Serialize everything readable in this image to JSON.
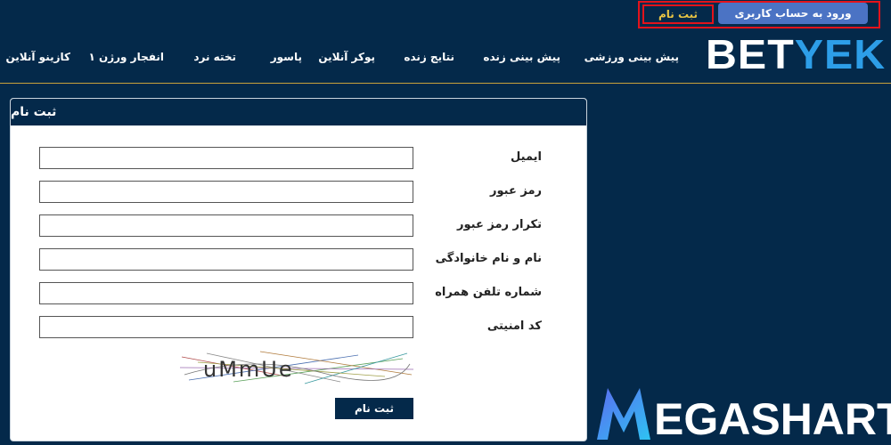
{
  "auth": {
    "register_label": "ثبت نام",
    "login_label": "ورود به حساب کاربری"
  },
  "logo": {
    "part1": "BET",
    "part2": "YEK"
  },
  "nav": {
    "items": [
      "پیش بینی ورزشی",
      "پیش بینی زنده",
      "نتایج زنده",
      "پوکر آنلاین",
      "پاسور",
      "تخته نرد",
      "انفجار ورژن ۱",
      "کازینو آنلاین"
    ]
  },
  "form": {
    "title": "ثبت نام",
    "fields": [
      {
        "label": "ایمیل",
        "value": ""
      },
      {
        "label": "رمز عبور",
        "value": ""
      },
      {
        "label": "تکرار رمز عبور",
        "value": ""
      },
      {
        "label": "نام و نام خانوادگی",
        "value": ""
      },
      {
        "label": "شماره تلفن همراه",
        "value": ""
      },
      {
        "label": "کد امنیتی",
        "value": ""
      }
    ],
    "captcha_text": "uMmUe",
    "submit_label": "ثبت نام"
  },
  "watermark": {
    "text": "EGASHART"
  },
  "colors": {
    "background": "#04294a",
    "accent_red": "#e3131b",
    "accent_gold": "#e8c443",
    "login_blue": "#4b73c4",
    "logo_blue": "#2d9ee8"
  }
}
